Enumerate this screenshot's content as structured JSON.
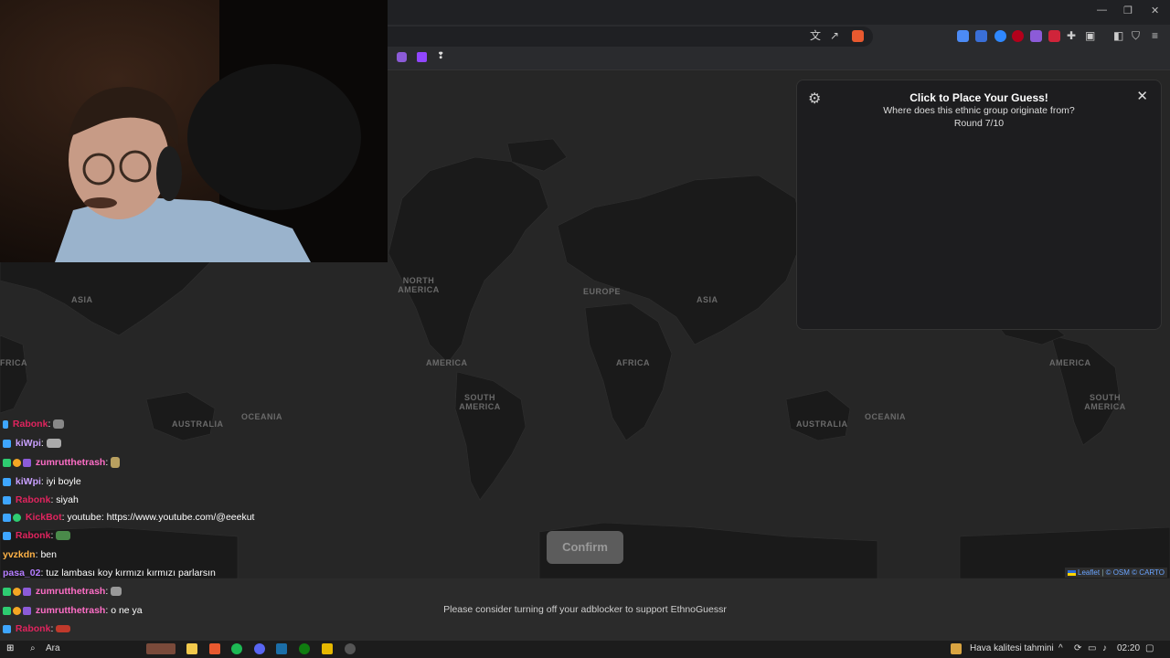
{
  "map": {
    "labels": {
      "asia_left": "ASIA",
      "africa_left": "FRICA",
      "australia_left": "AUSTRALIA",
      "oceania_left": "OCEANIA",
      "north_america": "NORTH AMERICA",
      "europe": "EUROPE",
      "asia_mid": "ASIA",
      "america_mid": "AMERICA",
      "africa_mid": "AFRICA",
      "south_america_mid": "SOUTH AMERICA",
      "australia_mid": "AUSTRALIA",
      "oceania_mid": "OCEANIA",
      "america_right": "AMERICA",
      "south_america_right": "SOUTH AMERICA"
    },
    "attribution": {
      "leaflet": "Leaflet",
      "sep1": "|",
      "osm": "© OSM",
      "carto": "© CARTO"
    }
  },
  "panel": {
    "title": "Click to Place Your Guess!",
    "question": "Where does this ethnic group originate from?",
    "round": "Round 7/10"
  },
  "confirm_label": "Confirm",
  "ad_notice": "Please consider turning off your adblocker to support EthnoGuessr",
  "chat": [
    {
      "user": "Rabonk",
      "sep": ":",
      "text": "",
      "color": "#e0245e"
    },
    {
      "user": "kiWpi",
      "sep": ":",
      "text": "",
      "color": "#c9a0ff"
    },
    {
      "user": "zumrutthetrash",
      "sep": ":",
      "text": "",
      "color": "#ff6ec7"
    },
    {
      "user": "kiWpi",
      "sep": ":",
      "text": "iyi boyle",
      "color": "#c9a0ff"
    },
    {
      "user": "Rabonk",
      "sep": ":",
      "text": "siyah",
      "color": "#e0245e"
    },
    {
      "user": "KickBot",
      "sep": ":",
      "text": "youtube: https://www.youtube.com/@eeekut",
      "color": "#e0245e"
    },
    {
      "user": "Rabonk",
      "sep": ":",
      "text": "",
      "color": "#e0245e"
    },
    {
      "user": "yvzkdn",
      "sep": ":",
      "text": "ben",
      "color": "#ffb347"
    },
    {
      "user": "pasa_02",
      "sep": ":",
      "text": "tuz lambası koy kırmızı kırmızı parlarsın",
      "color": "#b47cff"
    },
    {
      "user": "zumrutthetrash",
      "sep": ":",
      "text": "",
      "color": "#ff6ec7"
    },
    {
      "user": "zumrutthetrash",
      "sep": ":",
      "text": "o ne ya",
      "color": "#ff6ec7"
    },
    {
      "user": "Rabonk",
      "sep": ":",
      "text": "",
      "color": "#e0245e"
    }
  ],
  "taskbar": {
    "search_label": "Ara",
    "weather": "Hava kalitesi tahmini",
    "time": "02:20"
  }
}
